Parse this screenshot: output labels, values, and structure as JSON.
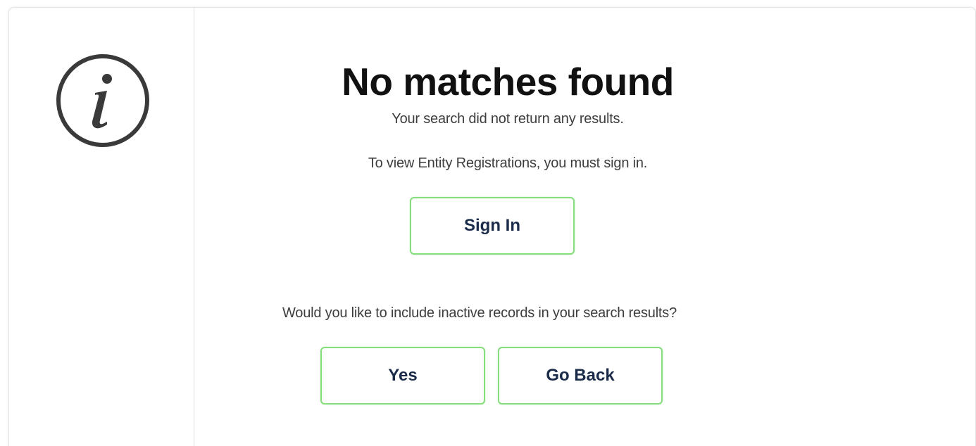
{
  "message": {
    "title": "No matches found",
    "subtitle": "Your search did not return any results.",
    "signin_prompt": "To view Entity Registrations, you must sign in.",
    "inactive_prompt": "Would you like to include inactive records in your search results?"
  },
  "buttons": {
    "sign_in": "Sign In",
    "yes": "Yes",
    "go_back": "Go Back"
  },
  "icons": {
    "info": "info-icon"
  },
  "colors": {
    "button_border": "#86dd7c",
    "button_text": "#1b2b4a",
    "title_text": "#111111",
    "body_text": "#3d3d3d",
    "icon": "#3a3a3a"
  }
}
